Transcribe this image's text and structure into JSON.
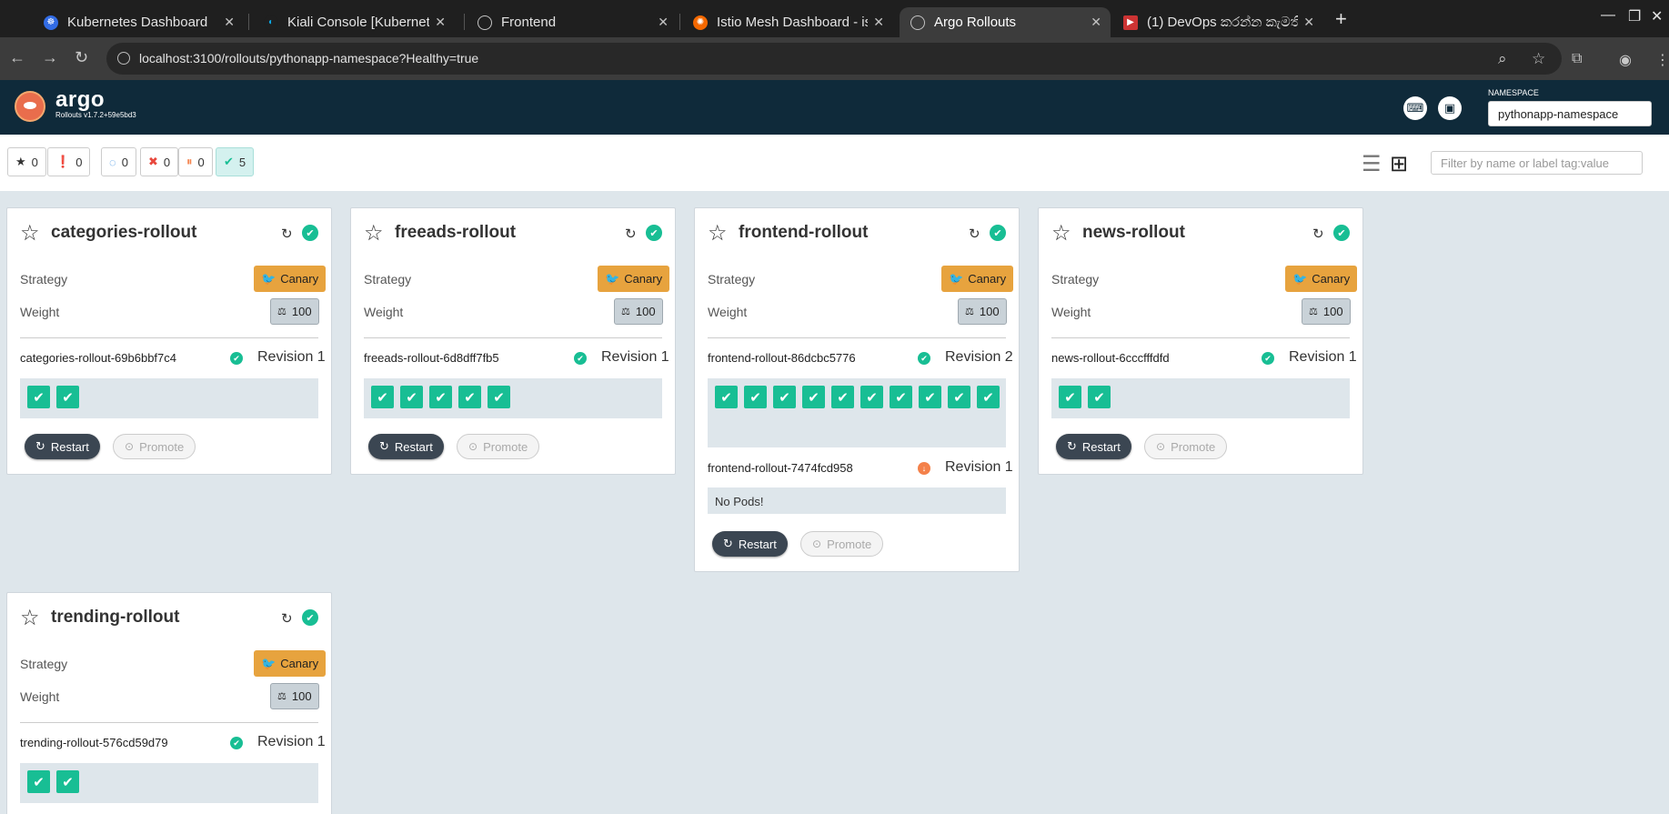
{
  "browser": {
    "tabs": [
      {
        "title": "Kubernetes Dashboard",
        "icon": "kubernetes-icon"
      },
      {
        "title": "Kiali Console [Kubernetes]",
        "icon": "kiali-icon"
      },
      {
        "title": "Frontend",
        "icon": "globe-icon"
      },
      {
        "title": "Istio Mesh Dashboard - istio",
        "icon": "grafana-icon"
      },
      {
        "title": "Argo Rollouts",
        "icon": "globe-icon"
      },
      {
        "title": "(1) DevOps කරන්න කැමති",
        "icon": "youtube-icon"
      }
    ],
    "url": "localhost:3100/rollouts/pythonapp-namespace?Healthy=true"
  },
  "header": {
    "brand": "argo",
    "version": "Rollouts v1.7.2+59e5bd3",
    "namespace_label": "NAMESPACE",
    "namespace_value": "pythonapp-namespace"
  },
  "filters": {
    "favorites": "0",
    "warnings": "0",
    "progressing": "0",
    "degraded": "0",
    "paused": "0",
    "healthy": "5",
    "search_placeholder": "Filter by name or label tag:value"
  },
  "labels": {
    "strategy": "Strategy",
    "weight": "Weight",
    "canary": "Canary",
    "restart": "Restart",
    "promote": "Promote",
    "no_pods": "No Pods!"
  },
  "rollouts": [
    {
      "name": "categories-rollout",
      "weight": "100",
      "replicasets": [
        {
          "name": "categories-rollout-69b6bbf7c4",
          "revision": "Revision 1",
          "pods": 2
        }
      ]
    },
    {
      "name": "freeads-rollout",
      "weight": "100",
      "replicasets": [
        {
          "name": "freeads-rollout-6d8dff7fb5",
          "revision": "Revision 1",
          "pods": 5
        }
      ]
    },
    {
      "name": "frontend-rollout",
      "weight": "100",
      "replicasets": [
        {
          "name": "frontend-rollout-86dcbc5776",
          "revision": "Revision 2",
          "pods": 10
        },
        {
          "name": "frontend-rollout-7474fcd958",
          "revision": "Revision 1",
          "pods": 0
        }
      ]
    },
    {
      "name": "news-rollout",
      "weight": "100",
      "replicasets": [
        {
          "name": "news-rollout-6cccfffdfd",
          "revision": "Revision 1",
          "pods": 2
        }
      ]
    },
    {
      "name": "trending-rollout",
      "weight": "100",
      "replicasets": [
        {
          "name": "trending-rollout-576cd59d79",
          "revision": "Revision 1",
          "pods": 2
        }
      ]
    }
  ]
}
